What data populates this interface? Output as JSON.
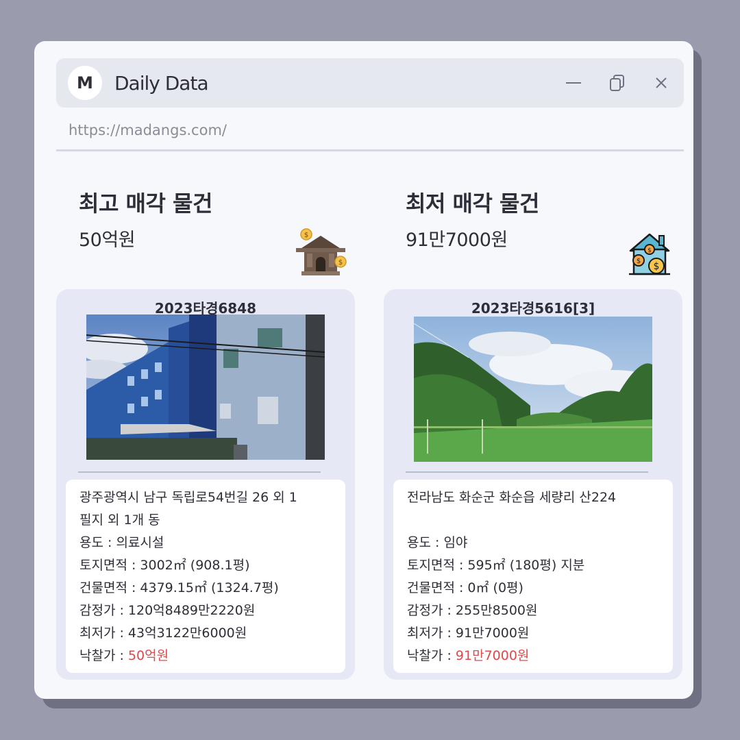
{
  "window": {
    "avatar_letter": "M",
    "title": "Daily Data",
    "url": "https://madangs.com/"
  },
  "left": {
    "heading": "최고 매각 물건",
    "price": "50억원",
    "case_no": "2023타경6848",
    "address_line1": "광주광역시 남구 독립로54번길 26 외 1",
    "address_line2": "필지 외 1개 동",
    "usage": "용도 : 의료시설",
    "land_area": "토지면적 : 3002㎡ (908.1평)",
    "building_area": "건물면적 : 4379.15㎡ (1324.7평)",
    "appraisal": "감정가 : 120억8489만2220원",
    "minimum": "최저가 : 43억3122만6000원",
    "winning_label": "낙찰가 : ",
    "winning_value": "50억원"
  },
  "right": {
    "heading": "최저 매각 물건",
    "price": "91만7000원",
    "case_no": "2023타경5616[3]",
    "address_line1": "전라남도 화순군 화순읍 세량리 산224",
    "usage": "용도 : 임야",
    "land_area": "토지면적 : 595㎡ (180평) 지분",
    "building_area": "건물면적 : 0㎡ (0평)",
    "appraisal": "감정가 : 255만8500원",
    "minimum": "최저가 : 91만7000원",
    "winning_label": "낙찰가 : ",
    "winning_value": "91만7000원"
  },
  "colors": {
    "accent_red": "#e04848",
    "window_bg": "#f7f8fc",
    "card_bg": "#e6e9f5"
  },
  "icons": [
    "minimize-icon",
    "restore-icon",
    "close-icon",
    "house-coin-icon",
    "house-dollar-icon"
  ]
}
